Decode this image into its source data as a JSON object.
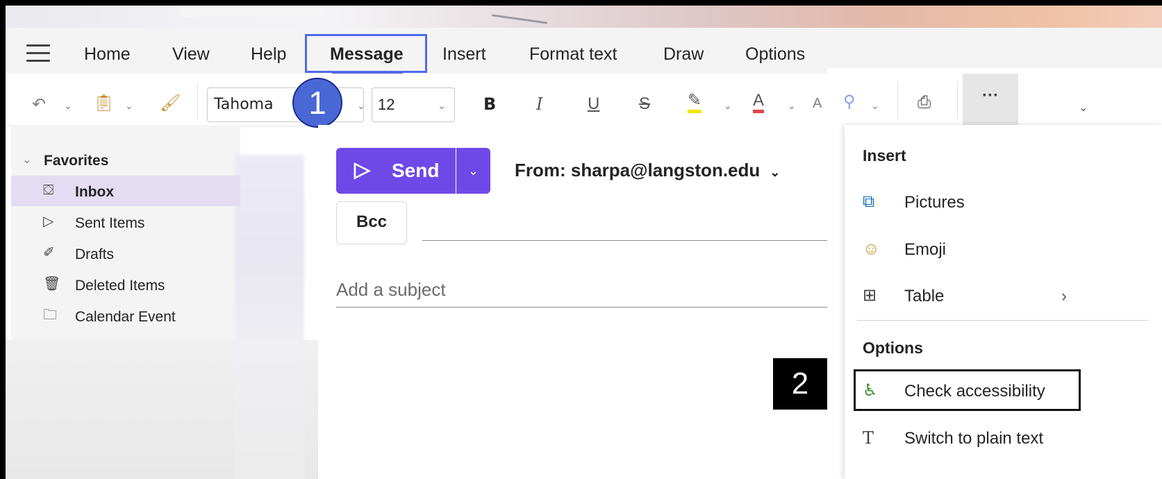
{
  "menu": {
    "items": [
      "Home",
      "View",
      "Help",
      "Message",
      "Insert",
      "Format text",
      "Draw",
      "Options"
    ],
    "active": "Message"
  },
  "ribbon": {
    "font_name": "Tahoma",
    "font_size": "12",
    "bold_label": "B",
    "italic_label": "I",
    "underline_label": "U",
    "strike_label": "S",
    "more_label": "···"
  },
  "annotations": {
    "step1": "1",
    "step2": "2"
  },
  "sidebar": {
    "favorites_label": "Favorites",
    "items": [
      {
        "label": "Inbox",
        "icon": "inbox-icon"
      },
      {
        "label": "Sent Items",
        "icon": "send-icon"
      },
      {
        "label": "Drafts",
        "icon": "drafts-icon"
      },
      {
        "label": "Deleted Items",
        "icon": "trash-icon"
      },
      {
        "label": "Calendar Event",
        "icon": "folder-icon"
      }
    ]
  },
  "compose": {
    "send_label": "Send",
    "from_label": "From: sharpa@langston.edu",
    "bcc_label": "Bcc",
    "subject_placeholder": "Add a subject"
  },
  "dropdown": {
    "insert_heading": "Insert",
    "insert_items": [
      {
        "label": "Pictures",
        "icon": "pictures-icon"
      },
      {
        "label": "Emoji",
        "icon": "emoji-icon"
      },
      {
        "label": "Table",
        "icon": "table-icon"
      }
    ],
    "options_heading": "Options",
    "options_items": [
      {
        "label": "Check accessibility",
        "icon": "accessibility-icon"
      },
      {
        "label": "Switch to plain text",
        "icon": "plain-text-icon"
      }
    ]
  },
  "colors": {
    "accent": "#6f49e8",
    "highlight_box": "#4f6bed",
    "selected_nav": "#e3dcf3"
  }
}
